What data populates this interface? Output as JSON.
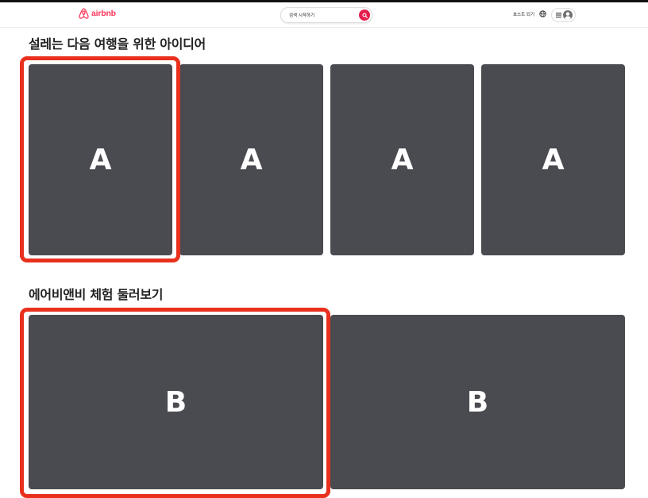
{
  "header": {
    "logo_text": "airbnb",
    "search_placeholder": "검색 시작하기",
    "host_link": "호스트 되기"
  },
  "sections": [
    {
      "title": "설레는 다음 여행을 위한 아이디어",
      "cards": [
        "A",
        "A",
        "A",
        "A"
      ]
    },
    {
      "title": "에어비앤비 체험 둘러보기",
      "cards": [
        "B",
        "B"
      ]
    }
  ],
  "colors": {
    "brand": "#ff385c",
    "search_button": "#e61e4d",
    "card": "#4a4b50",
    "highlight": "#e8301d"
  },
  "icons": [
    "airbnb-logo-icon",
    "search-icon",
    "globe-icon",
    "hamburger-menu-icon",
    "user-avatar-icon"
  ]
}
